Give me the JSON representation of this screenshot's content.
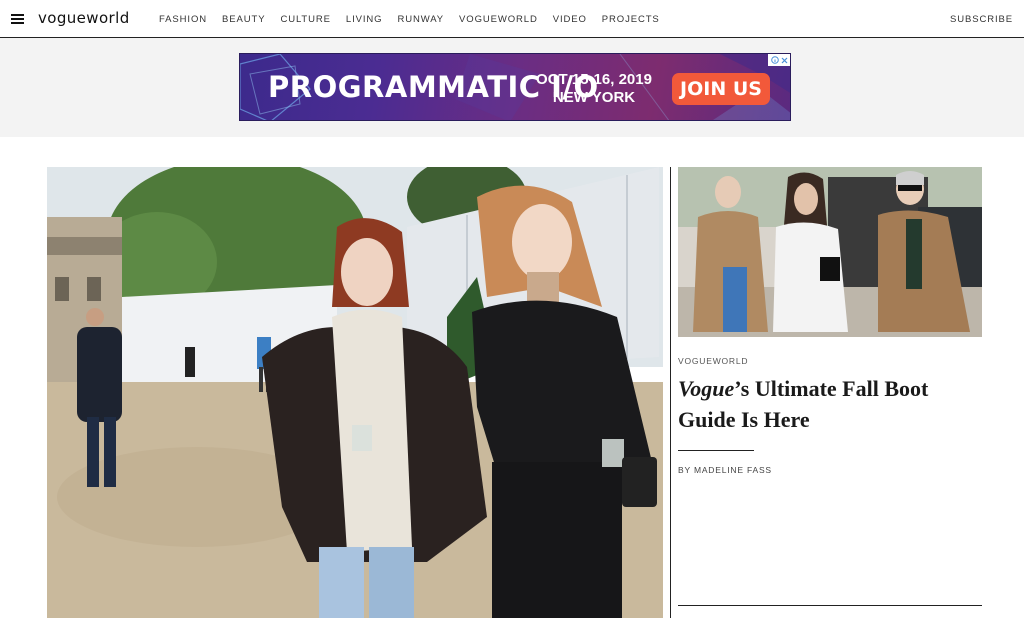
{
  "header": {
    "logo": "vogueworld",
    "nav": [
      "FASHION",
      "BEAUTY",
      "CULTURE",
      "LIVING",
      "RUNWAY",
      "VOGUEWORLD",
      "VIDEO",
      "PROJECTS"
    ],
    "subscribe": "SUBSCRIBE"
  },
  "ad": {
    "title": "PROGRAMMATIC I/O",
    "date": "OCT 15-16, 2019",
    "location": "NEW YORK",
    "cta": "JOIN US",
    "colors": {
      "cta": "#f2593a",
      "background": "#4b2c92"
    }
  },
  "side_story": {
    "section": "VOGUEWORLD",
    "headline_italic": "Vogue",
    "headline_rest": "’s Ultimate Fall Boot Guide Is Here",
    "byline": "BY MADELINE FASS"
  }
}
